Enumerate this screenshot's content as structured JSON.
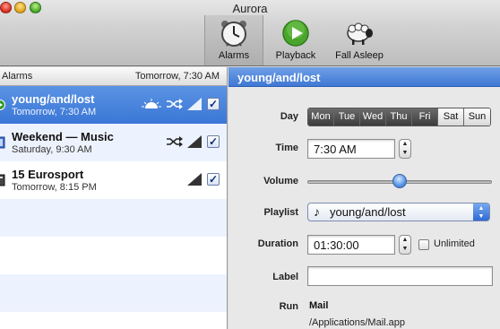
{
  "window": {
    "title": "Aurora"
  },
  "toolbar": {
    "alarms_label": "Alarms",
    "playback_label": "Playback",
    "fall_asleep_label": "Fall Asleep"
  },
  "list": {
    "header_title": "Alarms",
    "header_next": "Tomorrow, 7:30 AM",
    "items": [
      {
        "name": "young/and/lost",
        "time": "Tomorrow, 7:30 AM",
        "enabled": true,
        "selected": true,
        "icons": [
          "sunrise-icon",
          "shuffle-icon",
          "volume-ramp-icon"
        ]
      },
      {
        "name": "Weekend — Music",
        "time": "Saturday, 9:30 AM",
        "enabled": true,
        "selected": false,
        "icons": [
          "shuffle-icon",
          "volume-ramp-icon"
        ]
      },
      {
        "name": "15 Eurosport",
        "time": "Tomorrow, 8:15 PM",
        "enabled": true,
        "selected": false,
        "icons": [
          "volume-ramp-icon"
        ]
      }
    ]
  },
  "detail": {
    "title": "young/and/lost",
    "day_label": "Day",
    "days": [
      {
        "label": "Mon",
        "on": true
      },
      {
        "label": "Tue",
        "on": true
      },
      {
        "label": "Wed",
        "on": true
      },
      {
        "label": "Thu",
        "on": true
      },
      {
        "label": "Fri",
        "on": true
      },
      {
        "label": "Sat",
        "on": false
      },
      {
        "label": "Sun",
        "on": false
      }
    ],
    "time_label": "Time",
    "time_value": "7:30 AM",
    "volume_label": "Volume",
    "volume_fraction": 0.5,
    "playlist_label": "Playlist",
    "playlist_value": "young/and/lost",
    "duration_label": "Duration",
    "duration_value": "01:30:00",
    "unlimited_label": "Unlimited",
    "unlimited_checked": false,
    "label_label": "Label",
    "label_value": "",
    "run_label": "Run",
    "run_app": "Mail",
    "run_path": "/Applications/Mail.app"
  },
  "colors": {
    "selection_blue": "#3a76d6",
    "header_blue": "#4f86dc",
    "alt_row": "#edf3fe"
  }
}
